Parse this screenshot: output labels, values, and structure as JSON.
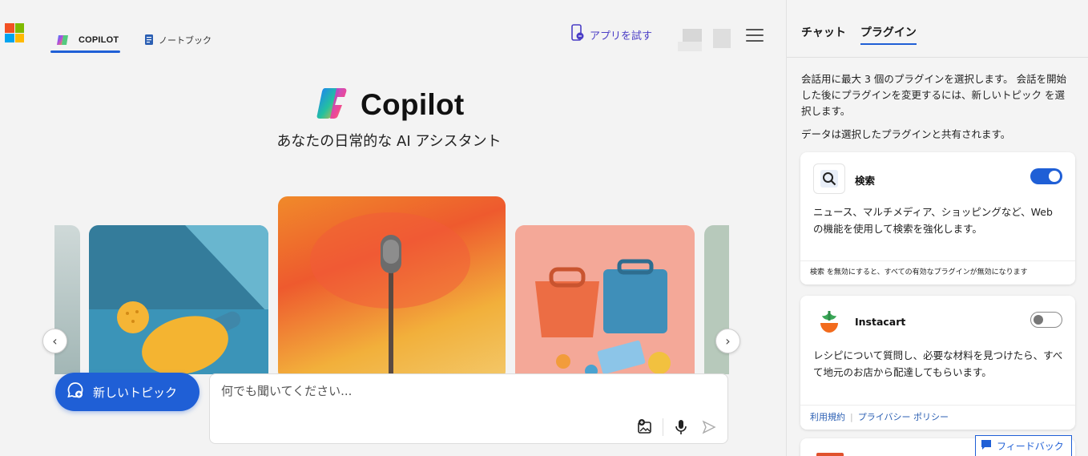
{
  "header": {
    "tabs": [
      {
        "label": "COPILOT",
        "active": true
      },
      {
        "label": "ノートブック",
        "active": false
      }
    ],
    "try_app_label": "アプリを試す"
  },
  "hero": {
    "brand": "Copilot",
    "tagline": "あなたの日常的な AI アシスタント"
  },
  "composer": {
    "new_topic_label": "新しいトピック",
    "placeholder": "何でも聞いてください..."
  },
  "panel": {
    "tabs": [
      {
        "label": "チャット",
        "active": false
      },
      {
        "label": "プラグイン",
        "active": true
      }
    ],
    "description": "会話用に最大 3 個のプラグインを選択します。 会話を開始した後にプラグインを変更するには、新しいトピック を選択します。",
    "share_note": "データは選択したプラグインと共有されます。",
    "plugins": [
      {
        "name": "検索",
        "enabled": true,
        "description": "ニュース、マルチメディア、ショッピングなど、Web の機能を使用して検索を強化します。",
        "footer": "検索 を無効にすると、すべての有効なプラグインが無効になります"
      },
      {
        "name": "Instacart",
        "enabled": false,
        "description": "レシピについて質問し、必要な材料を見つけたら、すべて地元のお店から配達してもらいます。",
        "links": [
          "利用規約",
          "プライバシー ポリシー"
        ]
      }
    ]
  },
  "feedback_label": "フィードバック",
  "colors": {
    "accent": "#1f5fd6",
    "try_app": "#4b3ec6"
  }
}
